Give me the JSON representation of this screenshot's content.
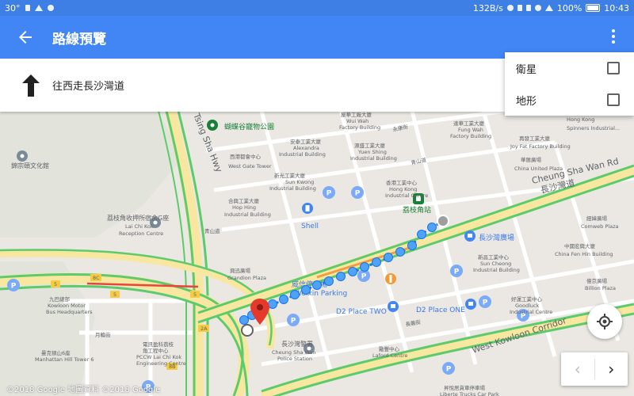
{
  "statusbar": {
    "temp": "30°",
    "speed": "132B/s",
    "battery": "100%",
    "time": "10:43"
  },
  "appbar": {
    "title": "路線預覽"
  },
  "direction": {
    "text": "往西走長沙灣道"
  },
  "menu": {
    "items": [
      {
        "label": "衛星"
      },
      {
        "label": "地形"
      }
    ]
  },
  "nav": {
    "prev": "‹",
    "next": "›"
  },
  "copyright": "©2018 Google  地圖資料 ©2018 Google",
  "map": {
    "labels": [
      {
        "text": "蝴蝶谷寵物公園",
        "cls": "lbl-green"
      },
      {
        "text": "Tsing Sha Hwy",
        "cls": "lbl-road"
      },
      {
        "text": "錦宗頤文化館",
        "cls": "lbl-m"
      },
      {
        "text": "荔枝角收押所宿舍G座",
        "cls": "lbl-m"
      },
      {
        "text": "Lai Chi Kok",
        "cls": "lbl-s"
      },
      {
        "text": "Reception Centre",
        "cls": "lbl-s"
      },
      {
        "text": "安泰工業大廈",
        "cls": "lbl-s"
      },
      {
        "text": "Alexandra",
        "cls": "lbl-s"
      },
      {
        "text": "Industrial Building",
        "cls": "lbl-s"
      },
      {
        "text": "西港都會中心",
        "cls": "lbl-s"
      },
      {
        "text": "West Gate Tower",
        "cls": "lbl-s"
      },
      {
        "text": "新光工業大廈",
        "cls": "lbl-s"
      },
      {
        "text": "Sun Kwong",
        "cls": "lbl-s"
      },
      {
        "text": "Industrial Building",
        "cls": "lbl-s"
      },
      {
        "text": "合興工業大廈",
        "cls": "lbl-s"
      },
      {
        "text": "Hop Hing",
        "cls": "lbl-s"
      },
      {
        "text": "Industrial Building",
        "cls": "lbl-s"
      },
      {
        "text": "屋華工廠大廈",
        "cls": "lbl-s"
      },
      {
        "text": "Wui Wah",
        "cls": "lbl-s"
      },
      {
        "text": "Factory Building",
        "cls": "lbl-s"
      },
      {
        "text": "源盛工業大廈",
        "cls": "lbl-s"
      },
      {
        "text": "Yuen Shing",
        "cls": "lbl-s"
      },
      {
        "text": "Industrial Building",
        "cls": "lbl-s"
      },
      {
        "text": "香港工業中心",
        "cls": "lbl-s"
      },
      {
        "text": "Hong Kong",
        "cls": "lbl-s"
      },
      {
        "text": "Industrial Centre",
        "cls": "lbl-s"
      },
      {
        "text": "荔枝角站",
        "cls": "lbl-green"
      },
      {
        "text": "達華工業大廈",
        "cls": "lbl-s"
      },
      {
        "text": "Fung Wah",
        "cls": "lbl-s"
      },
      {
        "text": "Factory Building",
        "cls": "lbl-s"
      },
      {
        "text": "再發工業大廈",
        "cls": "lbl-s"
      },
      {
        "text": "Joy Fat Factory Building",
        "cls": "lbl-s"
      },
      {
        "text": "華匯廣場",
        "cls": "lbl-s"
      },
      {
        "text": "China United Plaza",
        "cls": "lbl-s"
      },
      {
        "text": "Hong Kong",
        "cls": "lbl-s"
      },
      {
        "text": "Spinners Industrial...",
        "cls": "lbl-s"
      },
      {
        "text": "Cheung Sha Wan Rd",
        "cls": "lbl-road"
      },
      {
        "text": "長沙灣道",
        "cls": "lbl-road"
      },
      {
        "text": "長沙灣廣場",
        "cls": "lbl-blue"
      },
      {
        "text": "經緯廣場",
        "cls": "lbl-s"
      },
      {
        "text": "Comweb Plaza",
        "cls": "lbl-s"
      },
      {
        "text": "中國宏興大廈",
        "cls": "lbl-s"
      },
      {
        "text": "China Fen Hin Building",
        "cls": "lbl-s"
      },
      {
        "text": "新昌工業中心",
        "cls": "lbl-s"
      },
      {
        "text": "Sun Cheong",
        "cls": "lbl-s"
      },
      {
        "text": "Industrial Building",
        "cls": "lbl-s"
      },
      {
        "text": "億京廣場",
        "cls": "lbl-s"
      },
      {
        "text": "Billion Plaza",
        "cls": "lbl-s"
      },
      {
        "text": "Shell",
        "cls": "lbl-blue"
      },
      {
        "text": "青山道",
        "cls": "lbl-s"
      },
      {
        "text": "青山道",
        "cls": "lbl-s"
      },
      {
        "text": "永康街",
        "cls": "lbl-s"
      },
      {
        "text": "興迅廣場",
        "cls": "lbl-s"
      },
      {
        "text": "Grandion Plaza",
        "cls": "lbl-s"
      },
      {
        "text": "威信停車場",
        "cls": "lbl-blue"
      },
      {
        "text": "Weixin Parking",
        "cls": "lbl-blue"
      },
      {
        "text": "D2 Place TWO",
        "cls": "lbl-blue"
      },
      {
        "text": "D2 Place ONE",
        "cls": "lbl-blue"
      },
      {
        "text": "好運工業中心",
        "cls": "lbl-s"
      },
      {
        "text": "Goodluck",
        "cls": "lbl-s"
      },
      {
        "text": "Industrial Centre",
        "cls": "lbl-s"
      },
      {
        "text": "九巴總部",
        "cls": "lbl-s"
      },
      {
        "text": "Kowloon Motor",
        "cls": "lbl-s"
      },
      {
        "text": "Bus Headquarters",
        "cls": "lbl-s"
      },
      {
        "text": "曼克頓山6座",
        "cls": "lbl-s"
      },
      {
        "text": "Manhattan Hill Tower 6",
        "cls": "lbl-s"
      },
      {
        "text": "電訊盈科荔枝",
        "cls": "lbl-s"
      },
      {
        "text": "角工程中心",
        "cls": "lbl-s"
      },
      {
        "text": "PCCW Lai Chi Kok",
        "cls": "lbl-s"
      },
      {
        "text": "Engineering Centre",
        "cls": "lbl-s"
      },
      {
        "text": "長沙灣警署",
        "cls": "lbl-m"
      },
      {
        "text": "Cheung Sha Wan",
        "cls": "lbl-s"
      },
      {
        "text": "Police Station",
        "cls": "lbl-s"
      },
      {
        "text": "勵豐中心",
        "cls": "lbl-s"
      },
      {
        "text": "Laford Centre",
        "cls": "lbl-s"
      },
      {
        "text": "長義街",
        "cls": "lbl-s"
      },
      {
        "text": "月輪街",
        "cls": "lbl-s"
      },
      {
        "text": "West Kowloon Corridor",
        "cls": "lbl-road"
      },
      {
        "text": "昇悅居貨車停車場",
        "cls": "lbl-s"
      },
      {
        "text": "Liberte Trucks Car Park",
        "cls": "lbl-s"
      },
      {
        "text": "5",
        "cls": "lbl-s"
      },
      {
        "text": "5",
        "cls": "lbl-s"
      },
      {
        "text": "5",
        "cls": "lbl-s"
      },
      {
        "text": "8C",
        "cls": "lbl-s"
      },
      {
        "text": "2A",
        "cls": "lbl-s"
      },
      {
        "text": "8B",
        "cls": "lbl-s"
      }
    ]
  }
}
